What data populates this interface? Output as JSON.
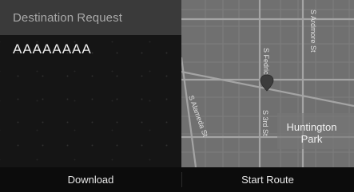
{
  "header": {
    "title": "Destination Request"
  },
  "destination": {
    "name": "AAAAAAAA"
  },
  "map": {
    "streets": {
      "s_ardmore": "S Ardmore St",
      "s_fedric": "S Fedric St",
      "s_alameda": "S Alameda St",
      "s_3rd": "S 3rd St"
    },
    "area_label_line1": "Huntington",
    "area_label_line2": "Park",
    "pin_icon": "map-pin-icon",
    "colors": {
      "land": "#707070",
      "major_road": "#9a9a9a",
      "minor_road": "#7d7d7d",
      "pin": "#3c3c3c"
    }
  },
  "actions": {
    "download_label": "Download",
    "start_route_label": "Start Route"
  }
}
